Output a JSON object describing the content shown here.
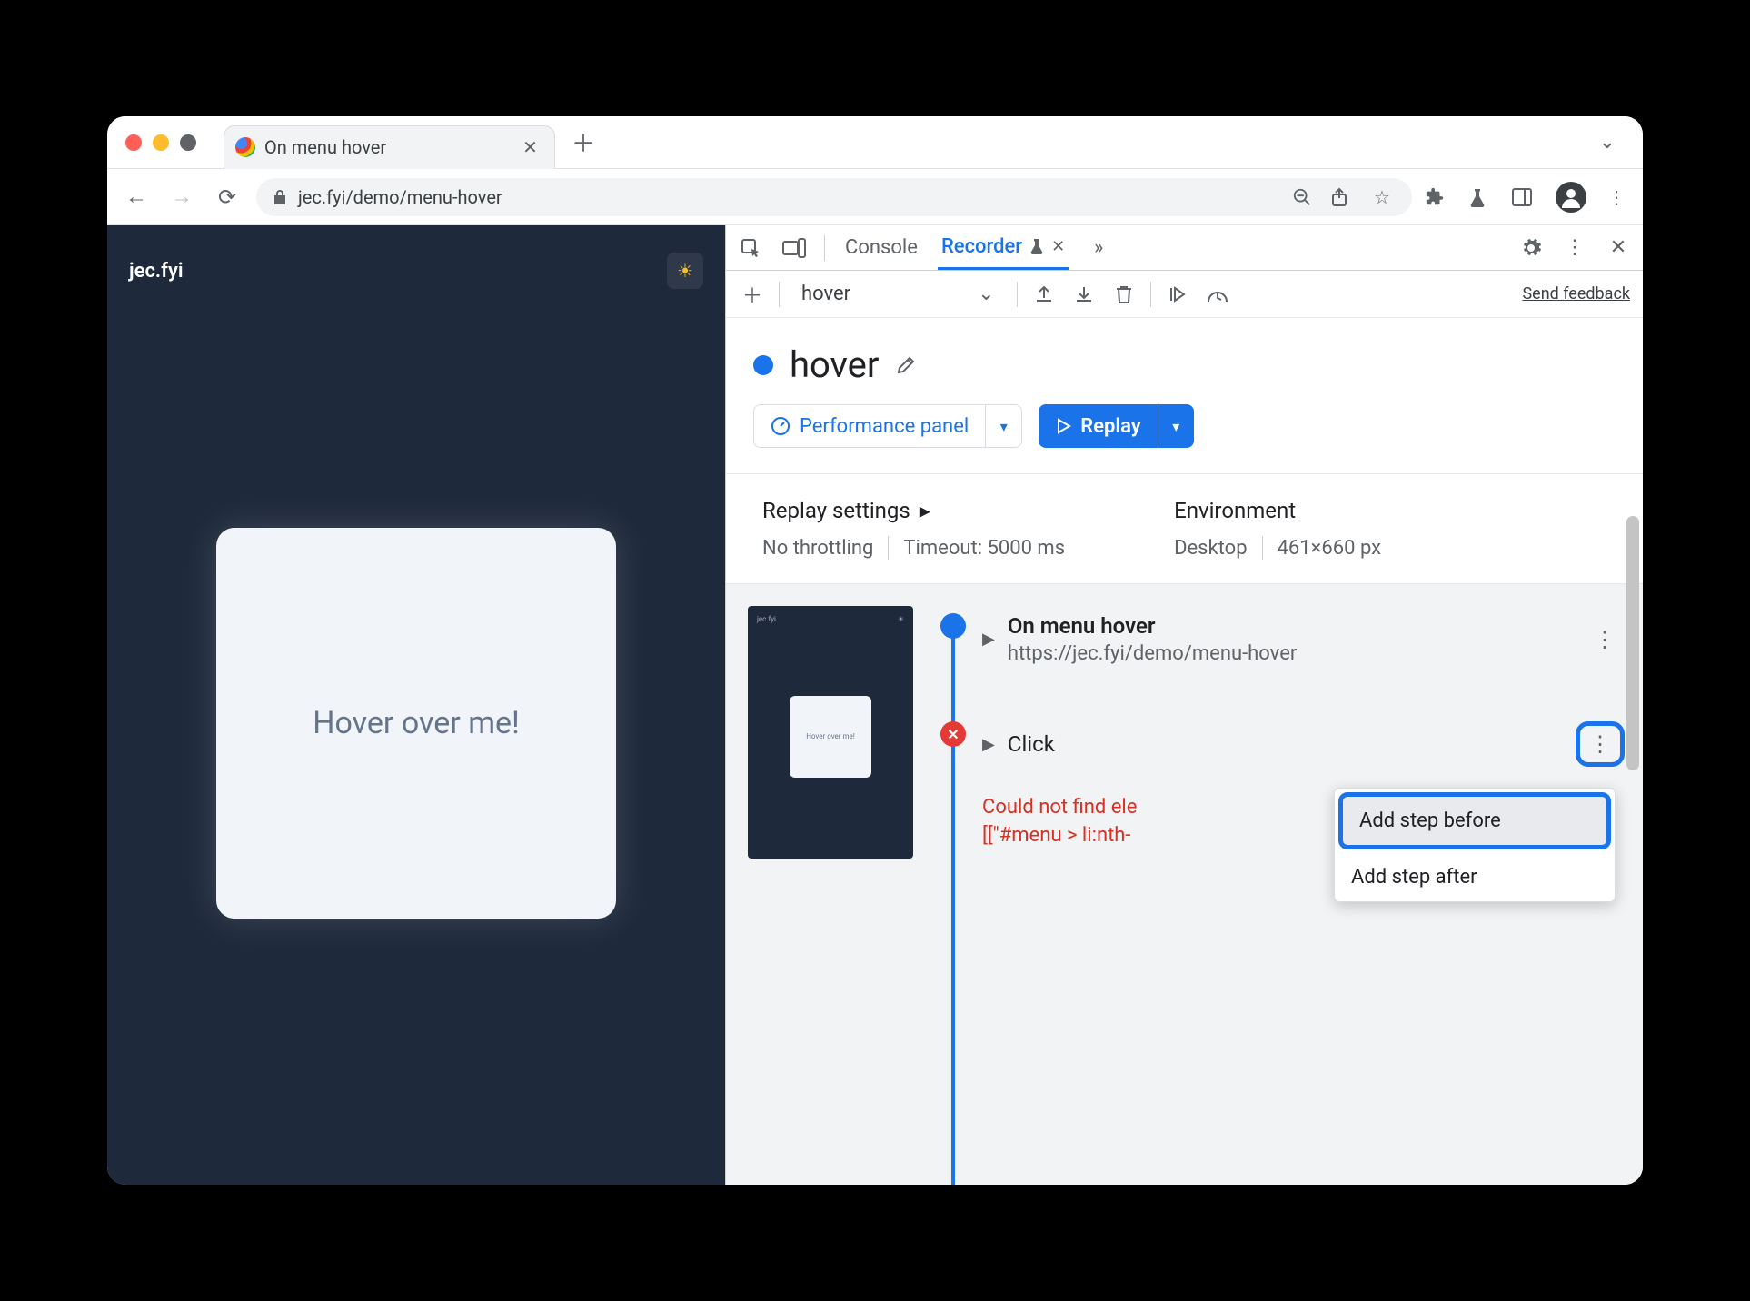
{
  "browser": {
    "tab_title": "On menu hover",
    "url": "jec.fyi/demo/menu-hover"
  },
  "page": {
    "brand": "jec.fyi",
    "card_text": "Hover over me!"
  },
  "devtools": {
    "tabs": {
      "console": "Console",
      "recorder": "Recorder"
    },
    "actionbar": {
      "recording_name": "hover",
      "feedback": "Send feedback"
    },
    "recording": {
      "title": "hover",
      "perf_btn": "Performance panel",
      "replay_btn": "Replay"
    },
    "settings": {
      "replay_heading": "Replay settings",
      "throttling": "No throttling",
      "timeout": "Timeout: 5000 ms",
      "env_heading": "Environment",
      "env_device": "Desktop",
      "env_dims": "461×660 px"
    },
    "steps": {
      "s1_title": "On menu hover",
      "s1_url": "https://jec.fyi/demo/menu-hover",
      "s2_title": "Click",
      "error_l1": "Could not find ele",
      "error_l2": "[[\"#menu > li:nth-",
      "thumb_text": "Hover over me!"
    },
    "context_menu": {
      "add_before": "Add step before",
      "add_after": "Add step after"
    }
  }
}
